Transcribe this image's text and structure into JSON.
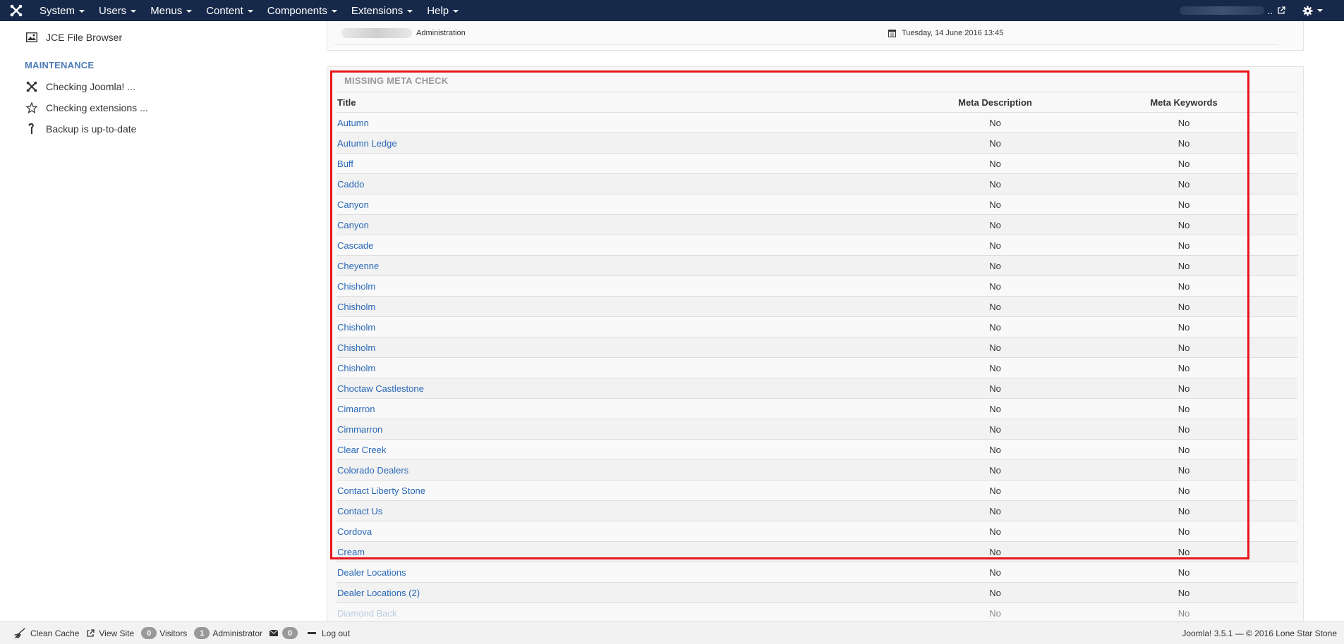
{
  "navbar": {
    "menu": [
      "System",
      "Users",
      "Menus",
      "Content",
      "Components",
      "Extensions",
      "Help"
    ],
    "user_ellipsis": ".."
  },
  "sidebar": {
    "jce_label": "JCE File Browser",
    "maintenance_heading": "MAINTENANCE",
    "checking_joomla": "Checking Joomla! ...",
    "checking_extensions": "Checking extensions ...",
    "backup_label": "Backup is up-to-date"
  },
  "info": {
    "role": "Administration",
    "date": "Tuesday, 14 June 2016 13:45"
  },
  "meta_check": {
    "title": "MISSING META CHECK",
    "headers": {
      "title": "Title",
      "desc": "Meta Description",
      "keywords": "Meta Keywords"
    },
    "rows": [
      {
        "title": "Autumn",
        "desc": "No",
        "kw": "No"
      },
      {
        "title": "Autumn Ledge",
        "desc": "No",
        "kw": "No"
      },
      {
        "title": "Buff",
        "desc": "No",
        "kw": "No"
      },
      {
        "title": "Caddo",
        "desc": "No",
        "kw": "No"
      },
      {
        "title": "Canyon",
        "desc": "No",
        "kw": "No"
      },
      {
        "title": "Canyon",
        "desc": "No",
        "kw": "No"
      },
      {
        "title": "Cascade",
        "desc": "No",
        "kw": "No"
      },
      {
        "title": "Cheyenne",
        "desc": "No",
        "kw": "No"
      },
      {
        "title": "Chisholm",
        "desc": "No",
        "kw": "No"
      },
      {
        "title": "Chisholm",
        "desc": "No",
        "kw": "No"
      },
      {
        "title": "Chisholm",
        "desc": "No",
        "kw": "No"
      },
      {
        "title": "Chisholm",
        "desc": "No",
        "kw": "No"
      },
      {
        "title": "Chisholm",
        "desc": "No",
        "kw": "No"
      },
      {
        "title": "Choctaw Castlestone",
        "desc": "No",
        "kw": "No"
      },
      {
        "title": "Cimarron",
        "desc": "No",
        "kw": "No"
      },
      {
        "title": "Cimmarron",
        "desc": "No",
        "kw": "No"
      },
      {
        "title": "Clear Creek",
        "desc": "No",
        "kw": "No"
      },
      {
        "title": "Colorado Dealers",
        "desc": "No",
        "kw": "No"
      },
      {
        "title": "Contact Liberty Stone",
        "desc": "No",
        "kw": "No"
      },
      {
        "title": "Contact Us",
        "desc": "No",
        "kw": "No"
      },
      {
        "title": "Cordova",
        "desc": "No",
        "kw": "No"
      },
      {
        "title": "Cream",
        "desc": "No",
        "kw": "No"
      },
      {
        "title": "Dealer Locations",
        "desc": "No",
        "kw": "No"
      },
      {
        "title": "Dealer Locations (2)",
        "desc": "No",
        "kw": "No"
      },
      {
        "title": "Diamond Back",
        "desc": "No",
        "kw": "No"
      }
    ]
  },
  "statusbar": {
    "clean_cache": "Clean Cache",
    "view_site": "View Site",
    "visitors_count": "0",
    "visitors_label": "Visitors",
    "admin_count": "1",
    "admin_label": "Administrator",
    "messages_count": "0",
    "logout": "Log out",
    "version": "Joomla! 3.5.1  —  © 2016 Lone Star Stone"
  },
  "colors": {
    "navbar_bg": "#17294a",
    "link": "#2a69b8",
    "highlight": "#e8141c",
    "maintenance_heading": "#4d7bb5"
  },
  "icons": {
    "brand": "joomla-logo-icon",
    "jce": "image-icon",
    "checking_joomla": "joomla-icon",
    "checking_extensions": "star-icon",
    "backup": "backup-icon",
    "settings": "gear-icon",
    "external": "external-link-icon",
    "calendar": "calendar-icon"
  }
}
